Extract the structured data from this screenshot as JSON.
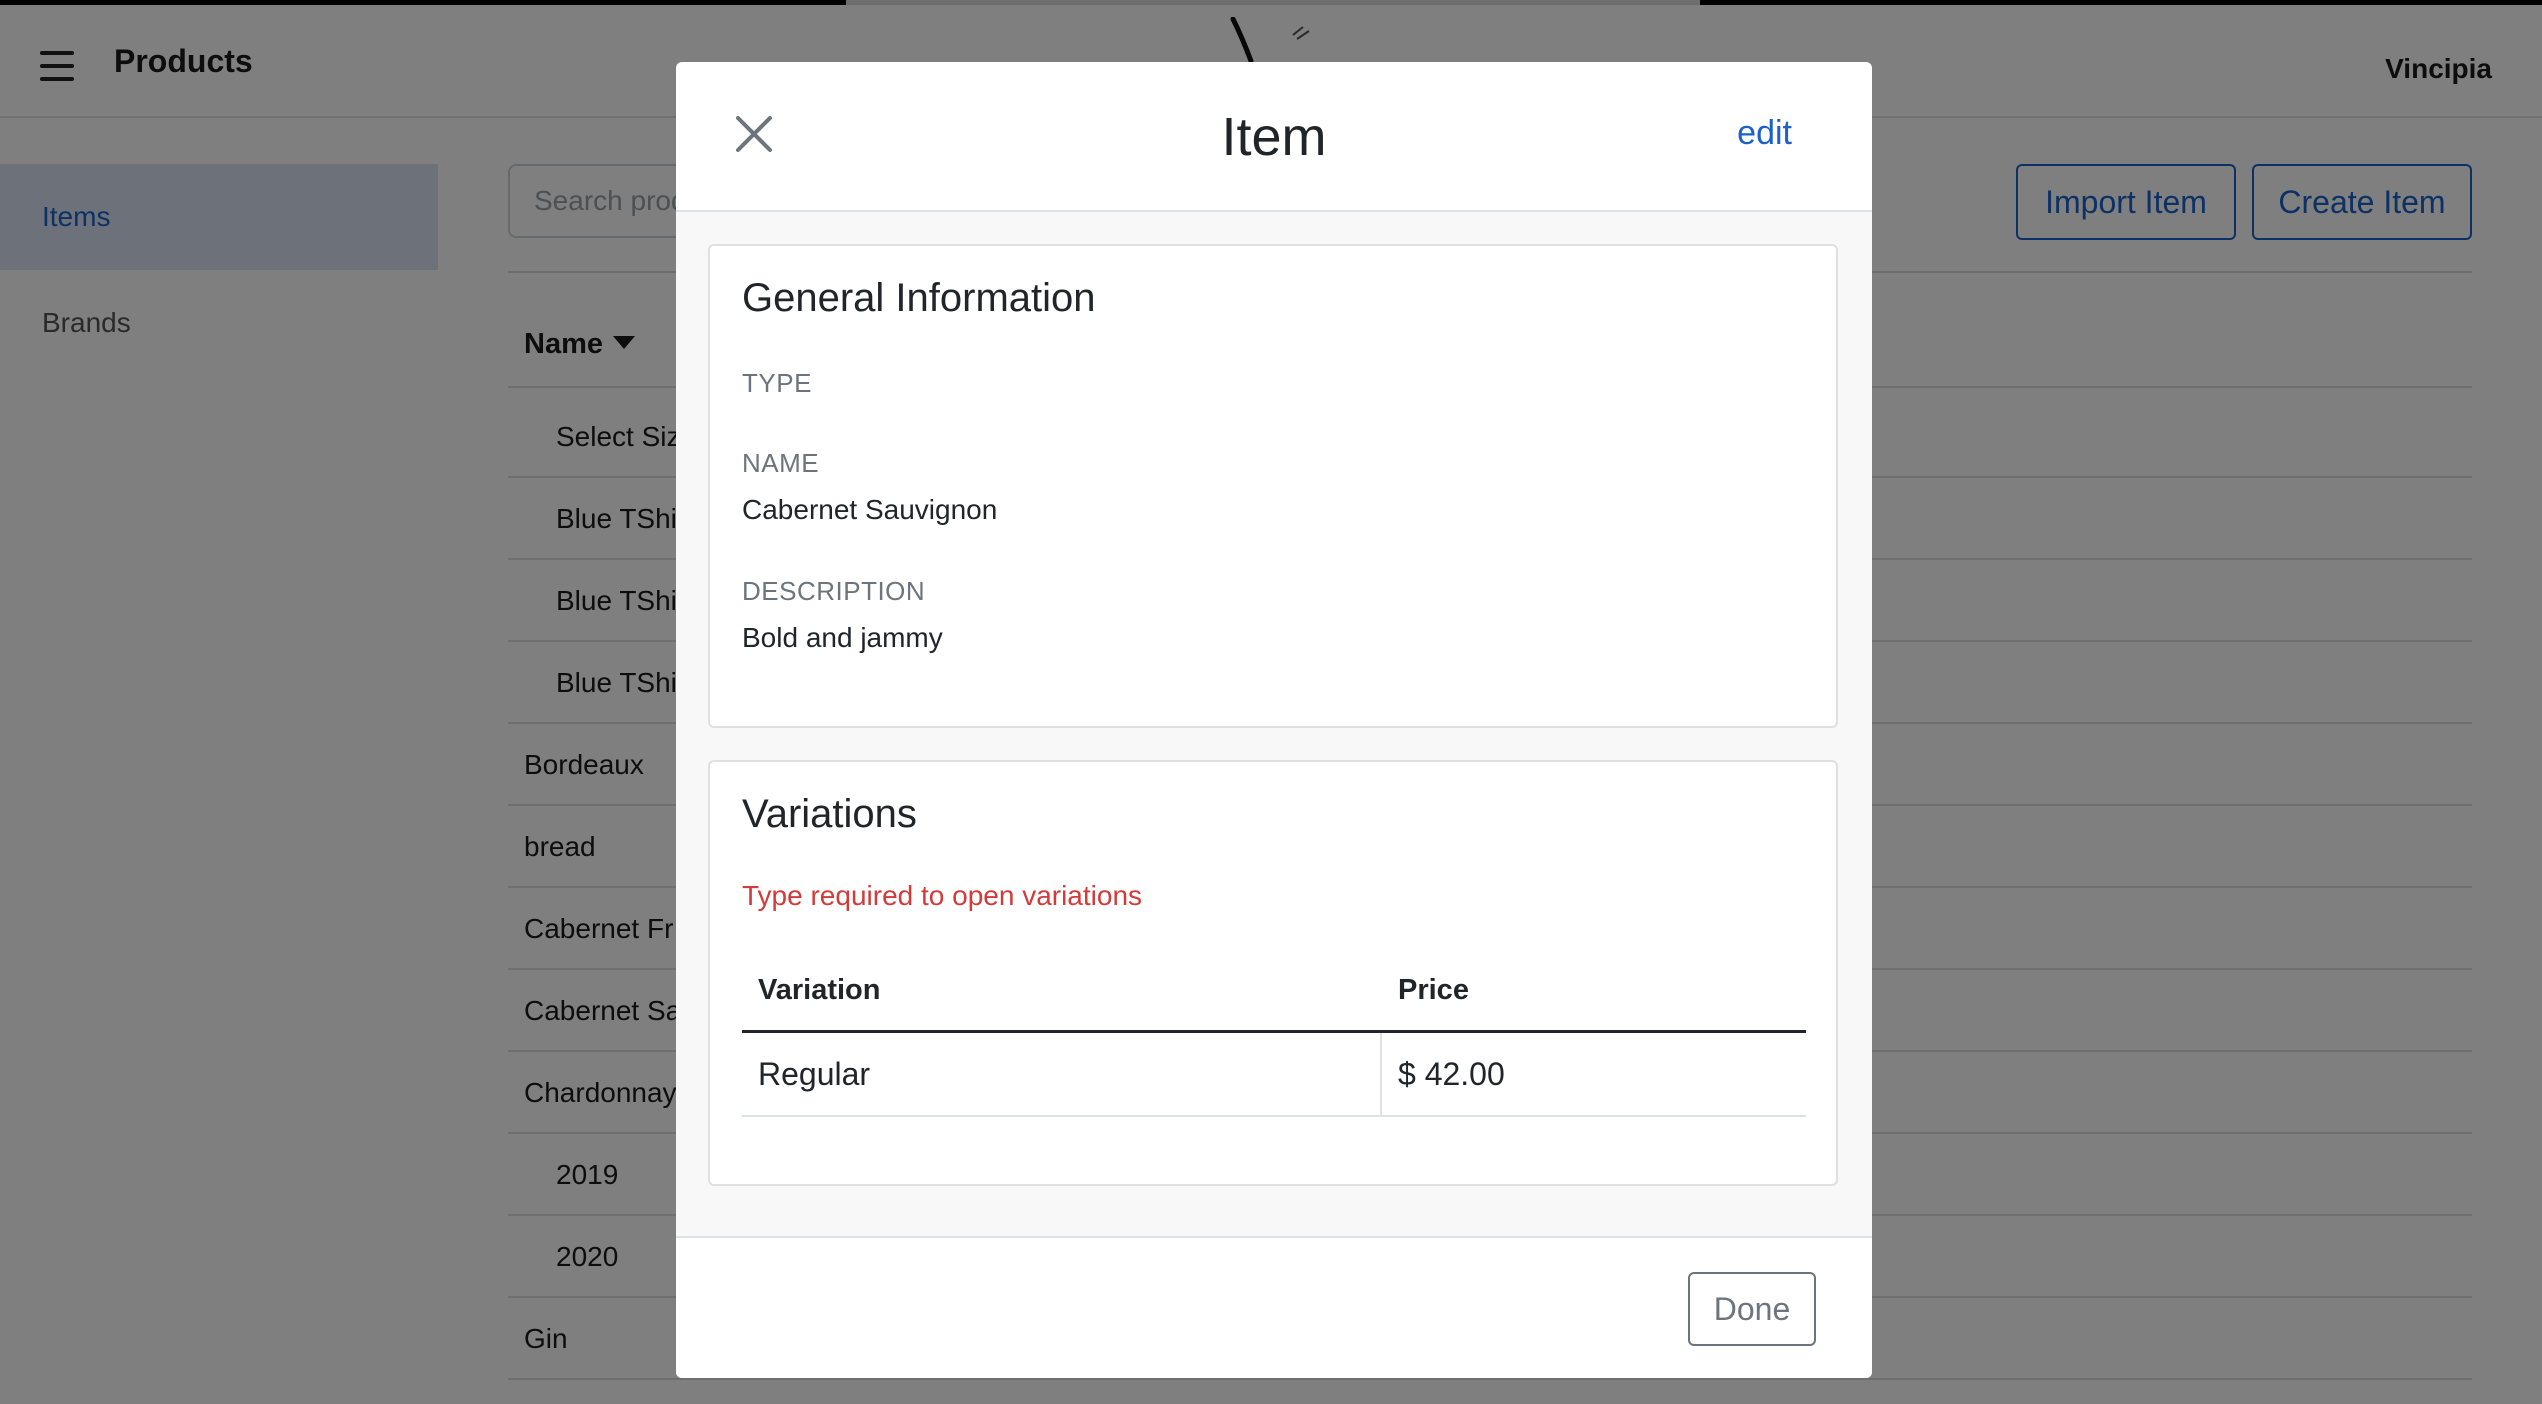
{
  "header": {
    "title": "Products",
    "user": "Vincipia"
  },
  "sidebar": {
    "items": [
      {
        "label": "Items",
        "active": true
      },
      {
        "label": "Brands",
        "active": false
      }
    ]
  },
  "main": {
    "search_placeholder": "Search prod",
    "import_label": "Import Item",
    "create_label": "Create Item",
    "column_name": "Name",
    "rows": [
      {
        "name": "Select Siz",
        "indent": true
      },
      {
        "name": "Blue TShi",
        "indent": true
      },
      {
        "name": "Blue TShi",
        "indent": true
      },
      {
        "name": "Blue TShi",
        "indent": true
      },
      {
        "name": "Bordeaux",
        "indent": false
      },
      {
        "name": "bread",
        "indent": false
      },
      {
        "name": "Cabernet Fr",
        "indent": false
      },
      {
        "name": "Cabernet Sa",
        "indent": false
      },
      {
        "name": "Chardonnay",
        "indent": false
      },
      {
        "name": "2019",
        "indent": true
      },
      {
        "name": "2020",
        "indent": true
      },
      {
        "name": "Gin",
        "indent": false
      }
    ]
  },
  "modal": {
    "title": "Item",
    "edit_label": "edit",
    "general": {
      "title": "General Information",
      "type_label": "TYPE",
      "type_value": "",
      "name_label": "NAME",
      "name_value": "Cabernet Sauvignon",
      "description_label": "DESCRIPTION",
      "description_value": "Bold and jammy"
    },
    "variations": {
      "title": "Variations",
      "error": "Type required to open variations",
      "col_variation": "Variation",
      "col_price": "Price",
      "rows": [
        {
          "variation": "Regular",
          "price": "$ 42.00"
        }
      ]
    },
    "done_label": "Done"
  },
  "colors": {
    "accent": "#1a62c9",
    "error": "#d43a3a",
    "overlay": "rgba(0,0,0,0.5)",
    "sidebar_active_bg": "#dbe5f5"
  }
}
